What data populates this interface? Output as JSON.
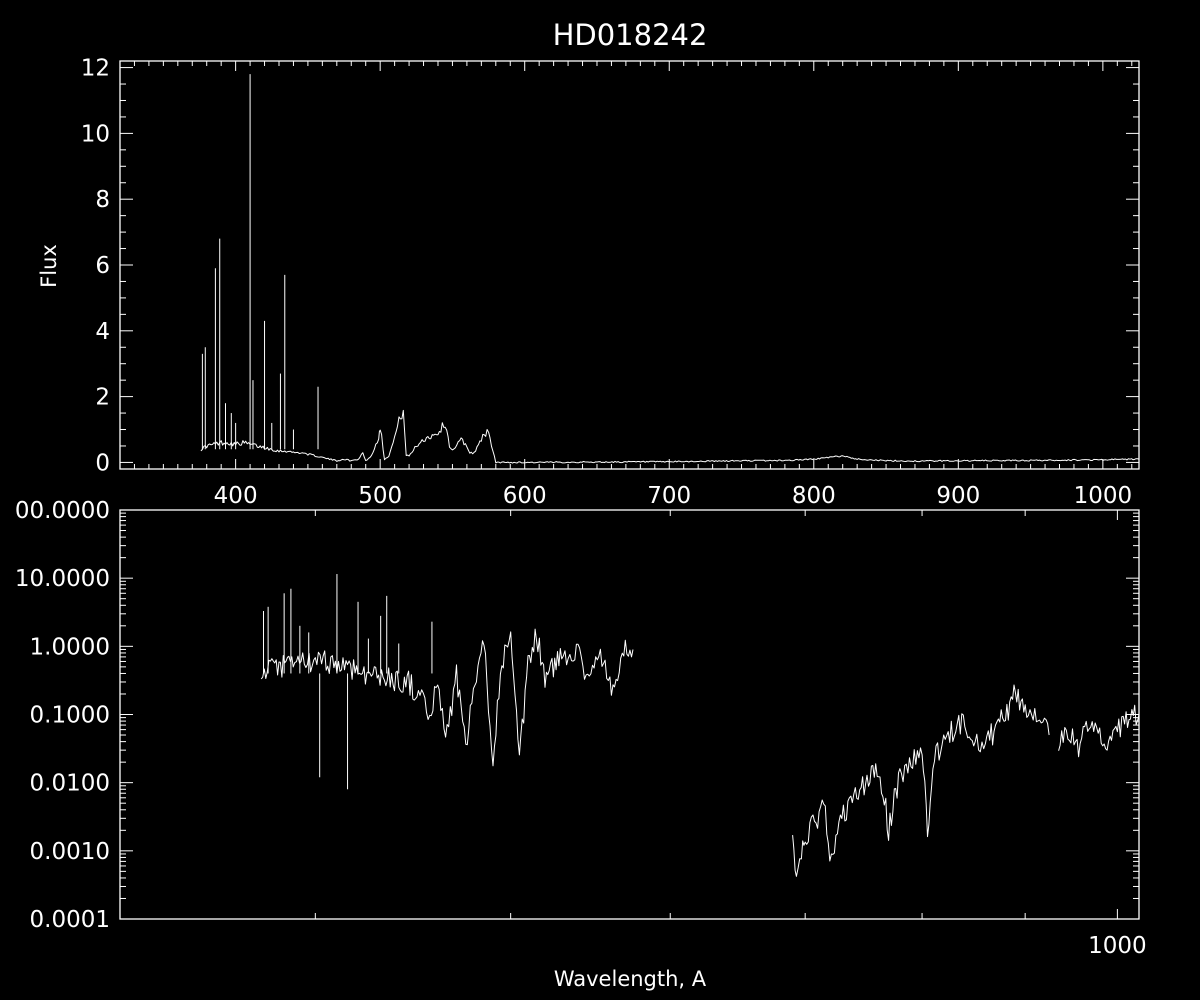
{
  "chart_data": [
    {
      "type": "line",
      "title": "HD018242",
      "ylabel": "Flux",
      "xlabel": "",
      "xlim": [
        320,
        1025
      ],
      "ylim": [
        -0.2,
        12.2
      ],
      "xticks": [
        400,
        500,
        600,
        700,
        800,
        900,
        1000
      ],
      "xtick_labels": [
        "400",
        "500",
        "600",
        "700",
        "800",
        "900",
        "1000"
      ],
      "yticks": [
        0,
        2,
        4,
        6,
        8,
        10,
        12
      ],
      "ytick_labels": [
        "0",
        "2",
        "4",
        "6",
        "8",
        "10",
        "12"
      ],
      "grid": false,
      "series": [
        {
          "x": [
            376,
            380,
            385,
            390,
            395,
            400,
            405,
            410,
            415,
            420,
            425,
            430,
            435,
            440,
            445,
            450,
            455,
            460,
            465,
            470,
            475,
            480,
            485,
            488,
            490,
            493,
            496,
            499,
            500,
            503,
            506,
            509,
            512,
            515,
            516,
            518,
            520,
            525,
            530,
            535,
            540,
            545,
            548,
            550,
            553,
            556,
            559,
            562,
            565,
            568,
            571,
            574,
            576,
            580,
            600,
            650,
            700,
            750,
            780,
            800,
            810,
            820,
            830,
            840,
            850,
            870,
            900,
            950,
            1000,
            1025
          ],
          "y": [
            0.4,
            0.5,
            0.55,
            0.6,
            0.6,
            0.55,
            0.6,
            0.55,
            0.5,
            0.45,
            0.4,
            0.35,
            0.35,
            0.3,
            0.3,
            0.25,
            0.2,
            0.15,
            0.1,
            0.05,
            0.1,
            0.05,
            0.1,
            0.3,
            0.05,
            0.15,
            0.4,
            0.8,
            1.1,
            0.1,
            0.2,
            0.6,
            1.1,
            1.5,
            1.6,
            0.2,
            0.2,
            0.5,
            0.7,
            0.8,
            0.9,
            1.2,
            0.5,
            0.4,
            0.5,
            0.7,
            0.55,
            0.3,
            0.3,
            0.5,
            0.8,
            0.95,
            0.7,
            0.0,
            0.0,
            0.01,
            0.02,
            0.05,
            0.06,
            0.1,
            0.15,
            0.2,
            0.1,
            0.08,
            0.05,
            0.04,
            0.05,
            0.06,
            0.08,
            0.1
          ]
        }
      ],
      "spikes": [
        {
          "x": 377,
          "y": 3.3
        },
        {
          "x": 379,
          "y": 3.5
        },
        {
          "x": 386,
          "y": 5.9
        },
        {
          "x": 389,
          "y": 6.8
        },
        {
          "x": 393,
          "y": 1.8
        },
        {
          "x": 397,
          "y": 1.5
        },
        {
          "x": 400,
          "y": 1.2
        },
        {
          "x": 410,
          "y": 11.8
        },
        {
          "x": 412,
          "y": 2.5
        },
        {
          "x": 420,
          "y": 4.3
        },
        {
          "x": 425,
          "y": 1.2
        },
        {
          "x": 431,
          "y": 2.7
        },
        {
          "x": 434,
          "y": 5.7
        },
        {
          "x": 440,
          "y": 1.0
        },
        {
          "x": 457,
          "y": 2.3
        }
      ]
    },
    {
      "type": "line",
      "xlabel": "Wavelength, A",
      "ylabel": "",
      "xscale": "log",
      "yscale": "log",
      "xlim": [
        320,
        1025
      ],
      "ylim": [
        0.0001,
        100
      ],
      "xticks": [
        1000
      ],
      "xtick_labels": [
        "1000"
      ],
      "yticks": [
        0.0001,
        0.001,
        0.01,
        0.1,
        1,
        10,
        100
      ],
      "ytick_labels": [
        "0.0001",
        "0.0010",
        "0.0100",
        "0.1000",
        "1.0000",
        "10.0000",
        "00.0000"
      ],
      "grid": false,
      "series": [
        {
          "x": [
            376,
            380,
            385,
            390,
            395,
            400,
            405,
            410,
            415,
            420,
            425,
            430,
            435,
            440,
            445,
            450,
            455,
            460,
            465,
            470,
            475,
            480,
            485,
            490,
            495,
            500,
            505,
            510,
            515,
            520,
            525,
            530,
            535,
            540,
            545,
            550,
            555,
            560,
            565,
            570,
            575
          ],
          "y": [
            0.35,
            0.45,
            0.5,
            0.55,
            0.6,
            0.55,
            0.6,
            0.55,
            0.5,
            0.45,
            0.4,
            0.35,
            0.35,
            0.3,
            0.3,
            0.2,
            0.1,
            0.25,
            0.05,
            0.4,
            0.03,
            0.3,
            1.0,
            0.025,
            0.6,
            1.2,
            0.02,
            0.5,
            1.5,
            0.35,
            0.5,
            0.7,
            0.8,
            1.0,
            0.35,
            0.6,
            0.7,
            0.25,
            0.4,
            0.85,
            0.9
          ]
        },
        {
          "x": [
            690,
            693,
            697,
            700,
            710,
            715,
            720,
            725,
            730,
            740,
            750,
            760,
            765,
            770,
            775,
            780,
            790,
            800,
            805,
            810,
            820,
            830,
            840,
            850,
            855,
            860,
            870,
            880,
            890,
            900,
            905,
            910,
            920,
            925
          ],
          "y": [
            0.002,
            0.0003,
            0.0008,
            0.0015,
            0.003,
            0.005,
            0.0008,
            0.0015,
            0.003,
            0.006,
            0.01,
            0.015,
            0.008,
            0.002,
            0.006,
            0.012,
            0.02,
            0.03,
            0.002,
            0.02,
            0.04,
            0.06,
            0.08,
            0.045,
            0.035,
            0.04,
            0.06,
            0.1,
            0.2,
            0.12,
            0.1,
            0.11,
            0.1,
            0.05
          ]
        },
        {
          "x": [
            935,
            940,
            945,
            950,
            955,
            960,
            965,
            970,
            975,
            980,
            985,
            990,
            995,
            1000,
            1005,
            1010,
            1015,
            1020,
            1025
          ],
          "y": [
            0.04,
            0.045,
            0.05,
            0.06,
            0.03,
            0.05,
            0.07,
            0.09,
            0.08,
            0.05,
            0.045,
            0.03,
            0.04,
            0.06,
            0.07,
            0.08,
            0.09,
            0.1,
            0.1
          ]
        }
      ],
      "spikes": [
        {
          "x": 377,
          "y": 3.3
        },
        {
          "x": 379,
          "y": 3.8
        },
        {
          "x": 386,
          "y": 6.0
        },
        {
          "x": 389,
          "y": 7.0
        },
        {
          "x": 393,
          "y": 2.0
        },
        {
          "x": 397,
          "y": 1.6
        },
        {
          "x": 402,
          "y": 0.012
        },
        {
          "x": 410,
          "y": 11.5
        },
        {
          "x": 415,
          "y": 0.008
        },
        {
          "x": 420,
          "y": 4.5
        },
        {
          "x": 425,
          "y": 1.3
        },
        {
          "x": 431,
          "y": 2.8
        },
        {
          "x": 434,
          "y": 5.5
        },
        {
          "x": 440,
          "y": 1.1
        },
        {
          "x": 457,
          "y": 2.3
        }
      ]
    }
  ]
}
